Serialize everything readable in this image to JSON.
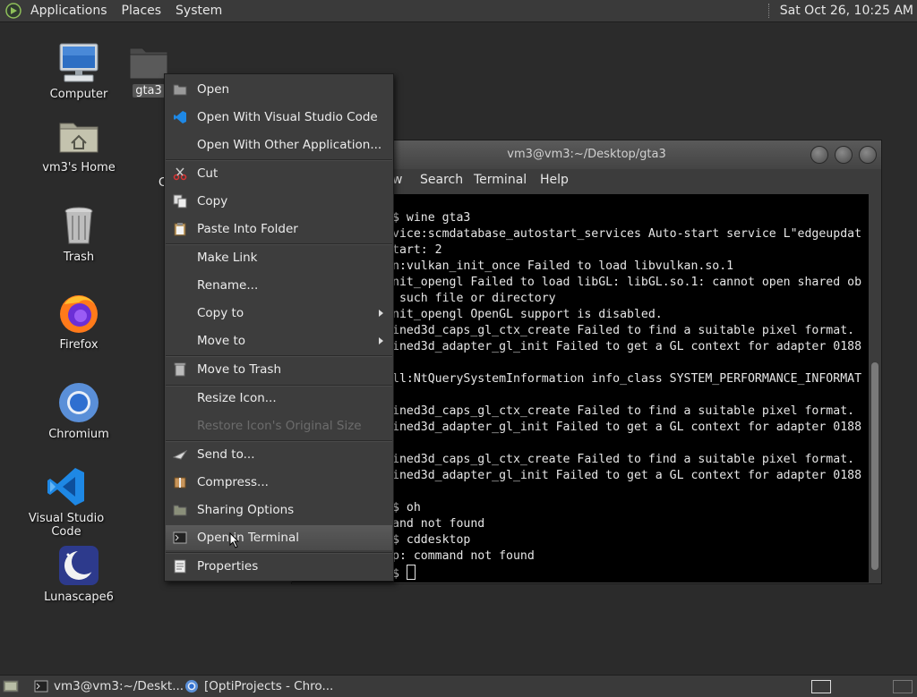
{
  "top_panel": {
    "menus": [
      "Applications",
      "Places",
      "System"
    ],
    "clock": "Sat Oct 26, 10:25 AM",
    "logo_icon": "app-menu-icon"
  },
  "desktop": {
    "icons": [
      {
        "label": "Computer",
        "icon": "computer-icon"
      },
      {
        "label": "vm3's Home",
        "icon": "home-folder-icon"
      },
      {
        "label": "Trash",
        "icon": "trash-icon"
      },
      {
        "label": "Firefox",
        "icon": "firefox-icon"
      },
      {
        "label": "Chromium",
        "icon": "chromium-icon"
      },
      {
        "label": "Visual Studio Code",
        "icon": "vscode-icon"
      },
      {
        "label": "Lunascape6",
        "icon": "lunascape-icon"
      },
      {
        "label": "gta3",
        "icon": "folder-icon"
      },
      {
        "label": "C",
        "icon": "partial-label"
      }
    ]
  },
  "terminal": {
    "title": "vm3@vm3:~/Desktop/gta3",
    "menus": [
      "w",
      "Search",
      "Terminal",
      "Help"
    ],
    "lines": [
      "$ wine gta3",
      "vice:scmdatabase_autostart_services Auto-start service L\"edgeupdat",
      "tart: 2",
      "n:vulkan_init_once Failed to load libvulkan.so.1",
      "nit_opengl Failed to load libGL: libGL.so.1: cannot open shared ob",
      " such file or directory",
      "nit_opengl OpenGL support is disabled.",
      "ined3d_caps_gl_ctx_create Failed to find a suitable pixel format.",
      "ined3d_adapter_gl_init Failed to get a GL context for adapter 0188",
      "",
      "ll:NtQuerySystemInformation info_class SYSTEM_PERFORMANCE_INFORMAT",
      "",
      "ined3d_caps_gl_ctx_create Failed to find a suitable pixel format.",
      "ined3d_adapter_gl_init Failed to get a GL context for adapter 0188",
      "",
      "ined3d_caps_gl_ctx_create Failed to find a suitable pixel format.",
      "ined3d_adapter_gl_init Failed to get a GL context for adapter 0188",
      "",
      "$ oh",
      "and not found",
      "$ cddesktop",
      "p: command not found",
      "$ "
    ]
  },
  "context_menu": {
    "items": [
      {
        "label": "Open",
        "icon": "folder-open-icon",
        "disabled": false,
        "submenu": false
      },
      {
        "label": "Open With Visual Studio Code",
        "icon": "vscode-small-icon",
        "disabled": false,
        "submenu": false
      },
      {
        "label": "Open With Other Application...",
        "icon": "",
        "disabled": false,
        "submenu": false
      },
      {
        "label": "Cut",
        "icon": "scissors-icon",
        "disabled": false,
        "submenu": false
      },
      {
        "label": "Copy",
        "icon": "copy-icon",
        "disabled": false,
        "submenu": false
      },
      {
        "label": "Paste Into Folder",
        "icon": "clipboard-icon",
        "disabled": false,
        "submenu": false
      },
      {
        "label": "Make Link",
        "icon": "",
        "disabled": false,
        "submenu": false
      },
      {
        "label": "Rename...",
        "icon": "",
        "disabled": false,
        "submenu": false
      },
      {
        "label": "Copy to",
        "icon": "",
        "disabled": false,
        "submenu": true
      },
      {
        "label": "Move to",
        "icon": "",
        "disabled": false,
        "submenu": true
      },
      {
        "label": "Move to Trash",
        "icon": "trash-small-icon",
        "disabled": false,
        "submenu": false
      },
      {
        "label": "Resize Icon...",
        "icon": "",
        "disabled": false,
        "submenu": false
      },
      {
        "label": "Restore Icon's Original Size",
        "icon": "",
        "disabled": true,
        "submenu": false
      },
      {
        "label": "Send to...",
        "icon": "send-icon",
        "disabled": false,
        "submenu": false
      },
      {
        "label": "Compress...",
        "icon": "archive-icon",
        "disabled": false,
        "submenu": false
      },
      {
        "label": "Sharing Options",
        "icon": "share-folder-icon",
        "disabled": false,
        "submenu": false
      },
      {
        "label": "Open in Terminal",
        "icon": "terminal-icon",
        "disabled": false,
        "submenu": false,
        "highlighted": true
      },
      {
        "label": "Properties",
        "icon": "properties-icon",
        "disabled": false,
        "submenu": false
      }
    ]
  },
  "taskbar": {
    "tasks": [
      {
        "label": "vm3@vm3:~/Deskt...",
        "icon": "terminal-icon"
      },
      {
        "label": "[OptiProjects - Chro...",
        "icon": "chromium-icon"
      }
    ]
  }
}
